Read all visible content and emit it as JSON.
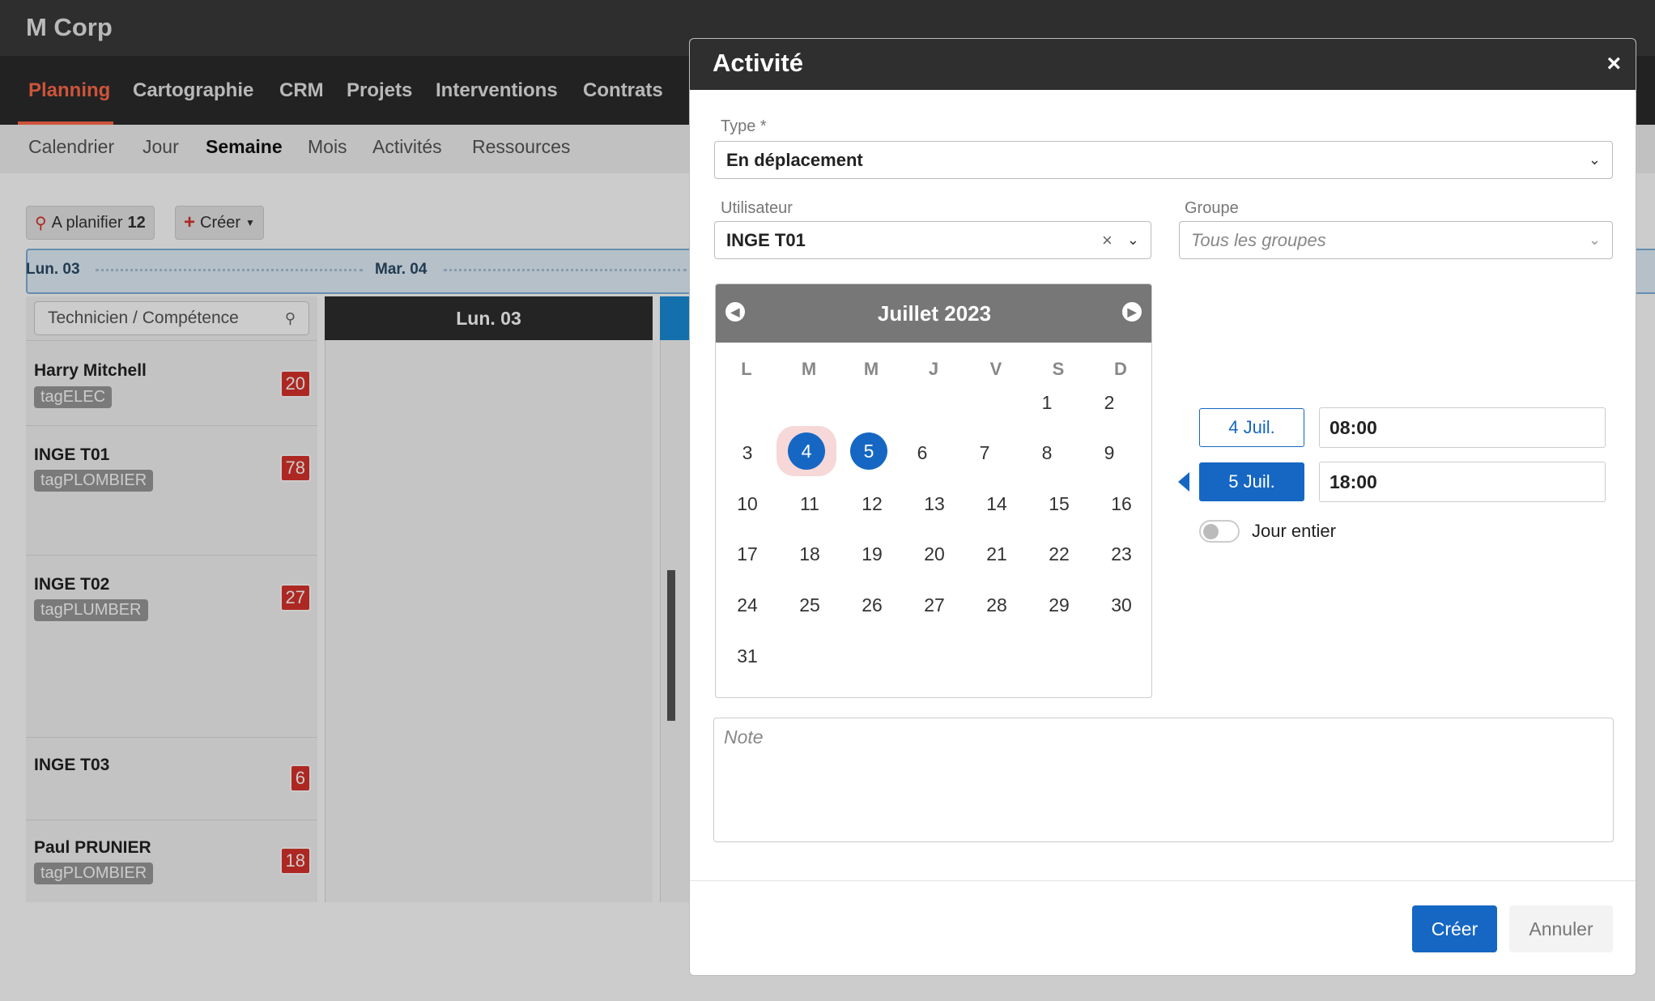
{
  "app": {
    "brand": "M Corp"
  },
  "main_nav": [
    "Planning",
    "Cartographie",
    "CRM",
    "Projets",
    "Interventions",
    "Contrats"
  ],
  "sub_nav": [
    "Calendrier",
    "Jour",
    "Semaine",
    "Mois",
    "Activités",
    "Ressources"
  ],
  "toolbar": {
    "plan_label": "A planifier",
    "plan_count": "12",
    "create_label": "Créer"
  },
  "timeline": {
    "day1": "Lun. 03",
    "day2": "Mar. 04"
  },
  "grid": {
    "search_placeholder": "Technicien / Compétence",
    "col1": "Lun. 03"
  },
  "technicians": [
    {
      "name": "Harry Mitchell",
      "tag": "tagELEC",
      "count": "20"
    },
    {
      "name": "INGE T01",
      "tag": "tagPLOMBIER",
      "count": "78"
    },
    {
      "name": "INGE T02",
      "tag": "tagPLUMBER",
      "count": "27"
    },
    {
      "name": "INGE T03",
      "tag": "",
      "count": "6"
    },
    {
      "name": "Paul PRUNIER",
      "tag": "tagPLOMBIER",
      "count": "18"
    }
  ],
  "modal": {
    "title": "Activité",
    "close": "×",
    "type_label": "Type *",
    "type_value": "En déplacement",
    "user_label": "Utilisateur",
    "user_value": "INGE T01",
    "group_label": "Groupe",
    "group_placeholder": "Tous les groupes",
    "calendar": {
      "month": "Juillet 2023",
      "weekdays": [
        "L",
        "M",
        "M",
        "J",
        "V",
        "S",
        "D"
      ],
      "weeks": [
        [
          "",
          "",
          "",
          "",
          "",
          "1",
          "2"
        ],
        [
          "3",
          "4",
          "5",
          "6",
          "7",
          "8",
          "9"
        ],
        [
          "10",
          "11",
          "12",
          "13",
          "14",
          "15",
          "16"
        ],
        [
          "17",
          "18",
          "19",
          "20",
          "21",
          "22",
          "23"
        ],
        [
          "24",
          "25",
          "26",
          "27",
          "28",
          "29",
          "30"
        ],
        [
          "31",
          "",
          "",
          "",
          "",
          "",
          ""
        ]
      ]
    },
    "start": {
      "date": "4 Juil.",
      "time": "08:00"
    },
    "end": {
      "date": "5 Juil.",
      "time": "18:00"
    },
    "all_day_label": "Jour entier",
    "note_placeholder": "Note",
    "create_button": "Créer",
    "cancel_button": "Annuler"
  },
  "colors": {
    "accent": "#ff6a4a",
    "primary": "#1667c3",
    "badge": "#d9332b",
    "header": "#2f2f2f"
  }
}
